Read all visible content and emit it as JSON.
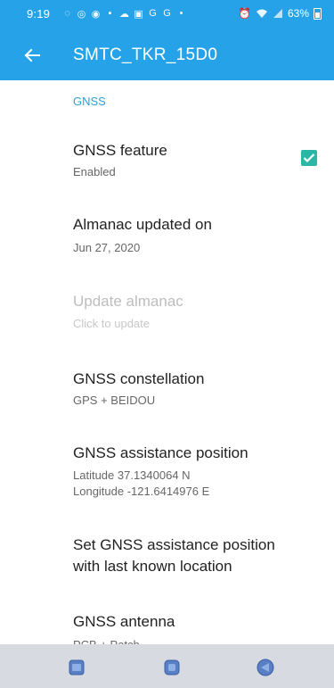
{
  "status_bar": {
    "time": "9:19",
    "battery": "63%"
  },
  "app_bar": {
    "title": "SMTC_TKR_15D0"
  },
  "section": {
    "header": "GNSS"
  },
  "items": [
    {
      "title": "GNSS feature",
      "summary": "Enabled",
      "checked": true
    },
    {
      "title": "Almanac updated on",
      "summary": "Jun 27, 2020"
    },
    {
      "title": "Update almanac",
      "summary": "Click to update",
      "disabled": true
    },
    {
      "title": "GNSS constellation",
      "summary": "GPS + BEIDOU"
    },
    {
      "title": "GNSS assistance position",
      "summary_line1": "Latitude 37.1340064 N",
      "summary_line2": "Longitude -121.6414976 E"
    },
    {
      "title_line1": "Set GNSS assistance position",
      "title_line2": "with last known location"
    },
    {
      "title": "GNSS antenna",
      "summary": "PCB + Patch"
    }
  ],
  "colors": {
    "primary": "#26a3e8",
    "accent": "#2bb6a6",
    "section_header": "#2a9fd6"
  }
}
